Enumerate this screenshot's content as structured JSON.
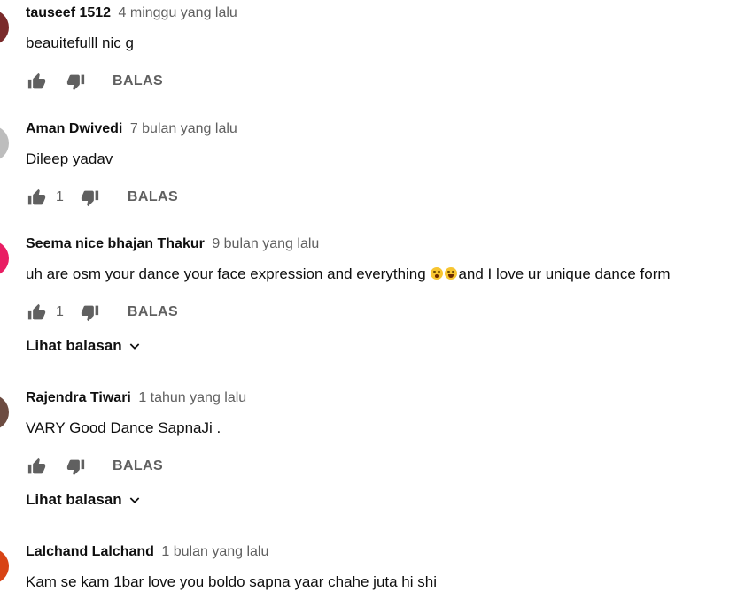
{
  "comments": [
    {
      "author": "tauseef 1512",
      "time": "4 minggu yang lalu",
      "text": "beauitefulll nic g",
      "likes": "",
      "reply": "BALAS",
      "view_replies": "",
      "avatar_color": "#7a2a2a"
    },
    {
      "author": "Aman Dwivedi",
      "time": "7 bulan yang lalu",
      "text": "Dileep yadav",
      "likes": "1",
      "reply": "BALAS",
      "view_replies": "",
      "avatar_color": "#bdbdbd"
    },
    {
      "author": "Seema nice bhajan Thakur",
      "time": "9 bulan yang lalu",
      "text_before": "uh are osm your dance your face expression and everything ",
      "text_after": "and I love ur unique dance form",
      "likes": "1",
      "reply": "BALAS",
      "view_replies": "Lihat balasan",
      "avatar_color": "#e91e63"
    },
    {
      "author": "Rajendra Tiwari",
      "time": "1 tahun yang lalu",
      "text": "VARY Good Dance SapnaJi .",
      "likes": "",
      "reply": "BALAS",
      "view_replies": "Lihat balasan",
      "avatar_color": "#6d4c41"
    },
    {
      "author": "Lalchand Lalchand",
      "time": "1 bulan yang lalu",
      "text": "Kam se kam 1bar love you boldo sapna yaar chahe juta hi shi",
      "likes": "",
      "reply": "",
      "view_replies": "",
      "avatar_color": "#d84315"
    }
  ],
  "icons": {
    "like": "thumb-up-icon",
    "dislike": "thumb-down-icon",
    "expand": "chevron-down-icon",
    "emoji1": "astonished-face-emoji",
    "emoji2": "grinning-face-emoji"
  },
  "colors": {
    "author": "#0f0f0f",
    "secondary": "#606060",
    "icon": "#606060"
  }
}
